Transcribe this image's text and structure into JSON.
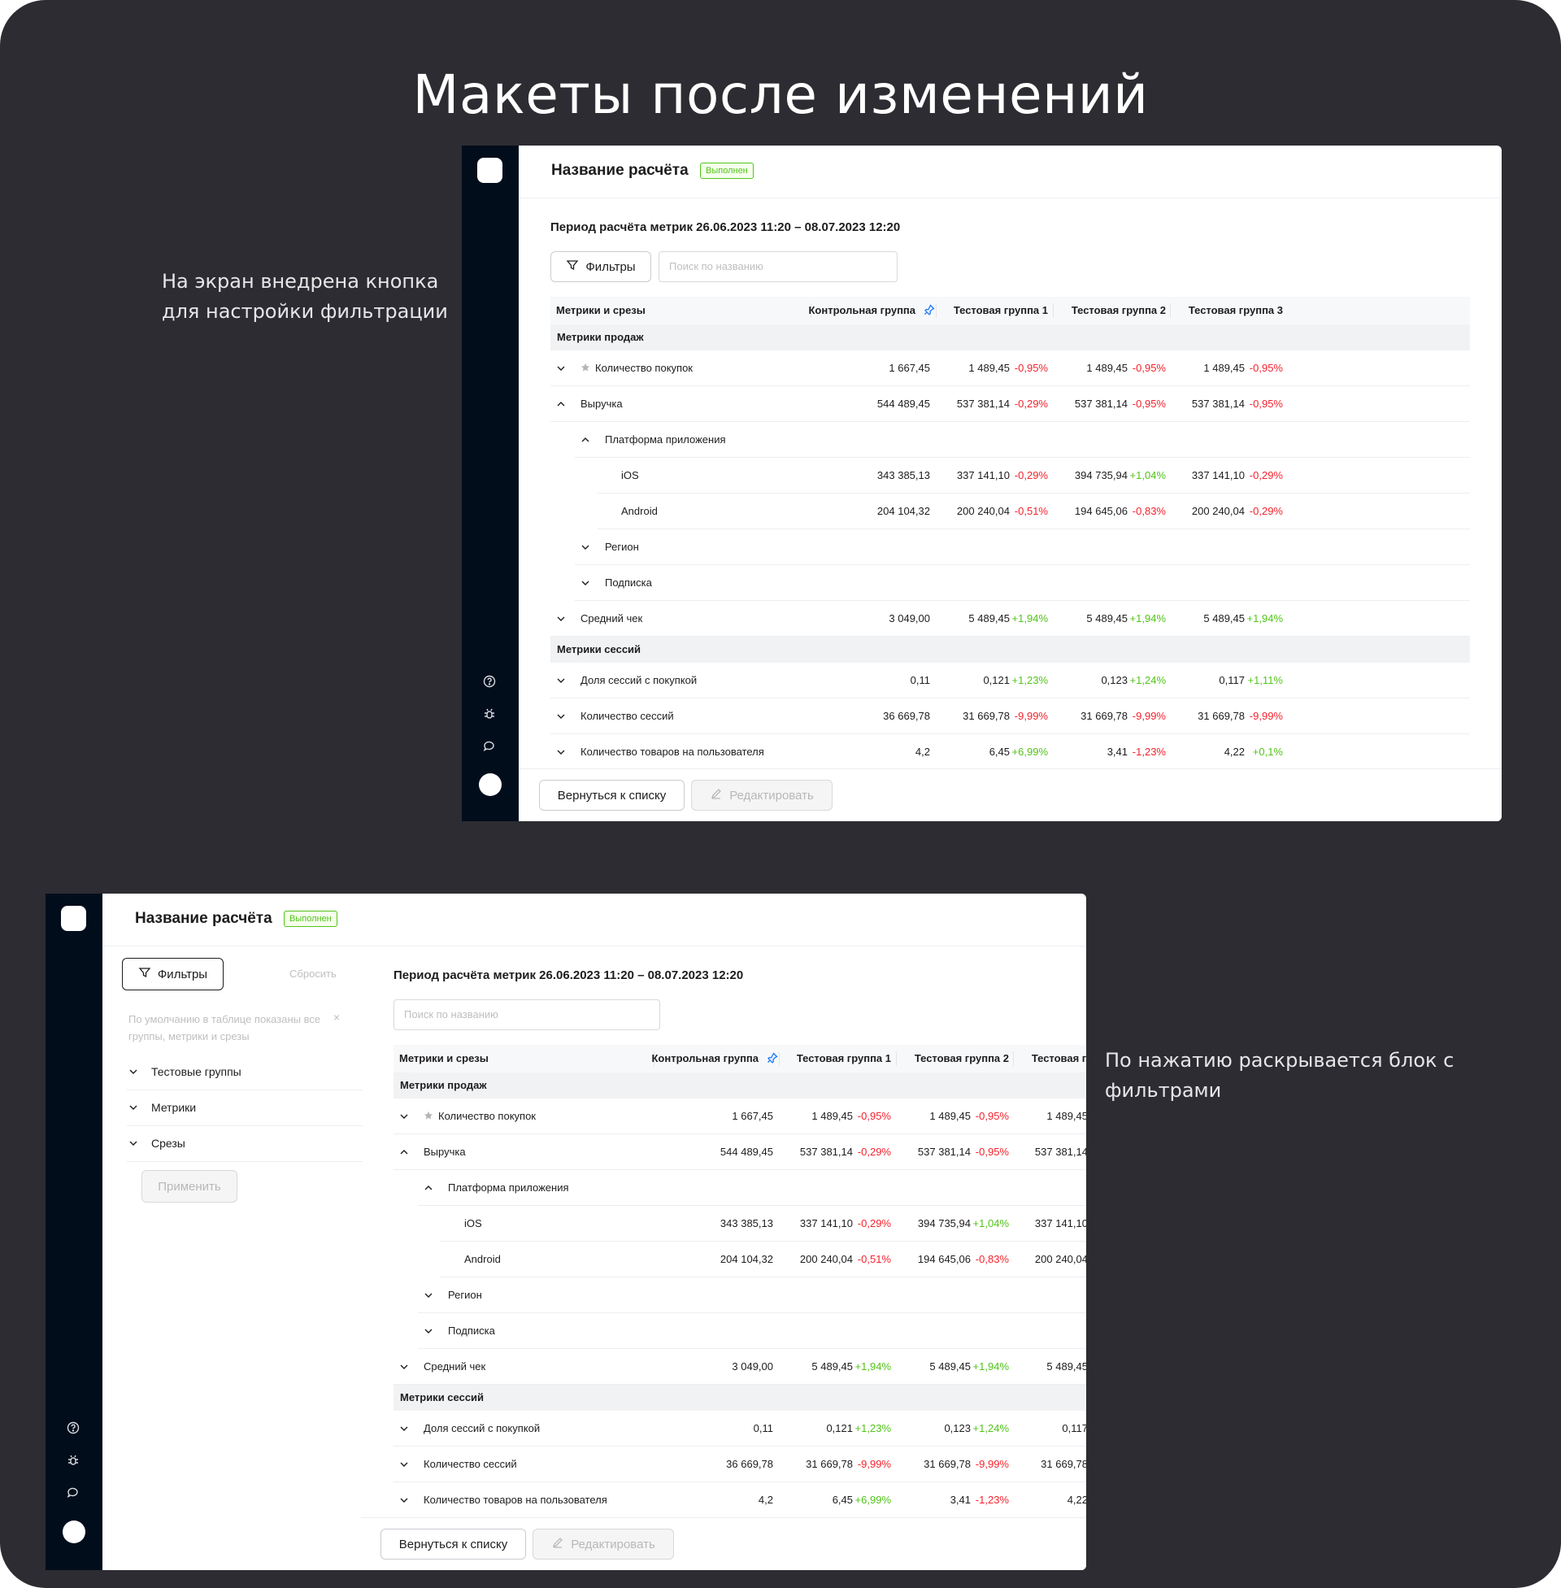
{
  "heading": "Макеты после изменений",
  "note_top": [
    "На экран внедрена кнопка",
    "для настройки фильтрации"
  ],
  "note_bottom": "По нажатию раскрывается блок с фильтрами",
  "colors": {
    "background": "#2d2c32",
    "sidebar": "#020d1c",
    "negative": "#f5222d",
    "positive": "#52c41a",
    "pin": "#1677ff"
  },
  "app": {
    "title": "Название расчёта",
    "status": "Выполнен",
    "period": "Период расчёта метрик 26.06.2023 11:20 – 08.07.2023 12:20",
    "filters_label": "Фильтры",
    "search_placeholder": "Поиск по названию",
    "back_label": "Вернуться к списку",
    "edit_label": "Редактировать",
    "sidebar_icons": [
      "help-icon",
      "bug-icon",
      "chat-icon"
    ],
    "columns": [
      "Метрики и срезы",
      "Контрольная группа",
      "Тестовая группа 1",
      "Тестовая группа 2",
      "Тестовая группа 3"
    ],
    "sections": [
      "Метрики продаж",
      "Метрики сессий"
    ],
    "rows": [
      {
        "name": "Количество покупок",
        "control": "1 667,45",
        "g1": "1 489,45",
        "d1": "-0,95%",
        "g2": "1 489,45",
        "d2": "-0,95%",
        "g3": "1 489,45",
        "d3": "-0,95%"
      },
      {
        "name": "Выручка",
        "control": "544 489,45",
        "g1": "537 381,14",
        "d1": "-0,29%",
        "g2": "537 381,14",
        "d2": "-0,95%",
        "g3": "537 381,14",
        "d3": "-0,95%"
      },
      {
        "name": "Платформа приложения"
      },
      {
        "name": "iOS",
        "control": "343 385,13",
        "g1": "337 141,10",
        "d1": "-0,29%",
        "g2": "394 735,94",
        "d2": "+1,04%",
        "g3": "337 141,10",
        "d3": "-0,29%"
      },
      {
        "name": "Android",
        "control": "204 104,32",
        "g1": "200 240,04",
        "d1": "-0,51%",
        "g2": "194 645,06",
        "d2": "-0,83%",
        "g3": "200 240,04",
        "d3": "-0,29%"
      },
      {
        "name": "Регион"
      },
      {
        "name": "Подписка"
      },
      {
        "name": "Средний чек",
        "control": "3 049,00",
        "g1": "5 489,45",
        "d1": "+1,94%",
        "g2": "5 489,45",
        "d2": "+1,94%",
        "g3": "5 489,45",
        "d3": "+1,94%"
      },
      {
        "name": "Доля сессий с покупкой",
        "control": "0,11",
        "g1": "0,121",
        "d1": "+1,23%",
        "g2": "0,123",
        "d2": "+1,24%",
        "g3": "0,117",
        "d3": "+1,11%"
      },
      {
        "name": "Количество сессий",
        "control": "36 669,78",
        "g1": "31 669,78",
        "d1": "-9,99%",
        "g2": "31 669,78",
        "d2": "-9,99%",
        "g3": "31 669,78",
        "d3": "-9,99%"
      },
      {
        "name": "Количество товаров на пользователя",
        "control": "4,2",
        "g1": "6,45",
        "d1": "+6,99%",
        "g2": "3,41",
        "d2": "-1,23%",
        "g3": "4,22",
        "d3": "+0,1%"
      }
    ],
    "filter_panel": {
      "reset_label": "Сбросить",
      "hint": "По умолчанию в таблице показаны все группы, метрики и срезы",
      "close_glyph": "×",
      "items": [
        "Тестовые группы",
        "Метрики",
        "Срезы"
      ],
      "apply_label": "Применить"
    }
  }
}
